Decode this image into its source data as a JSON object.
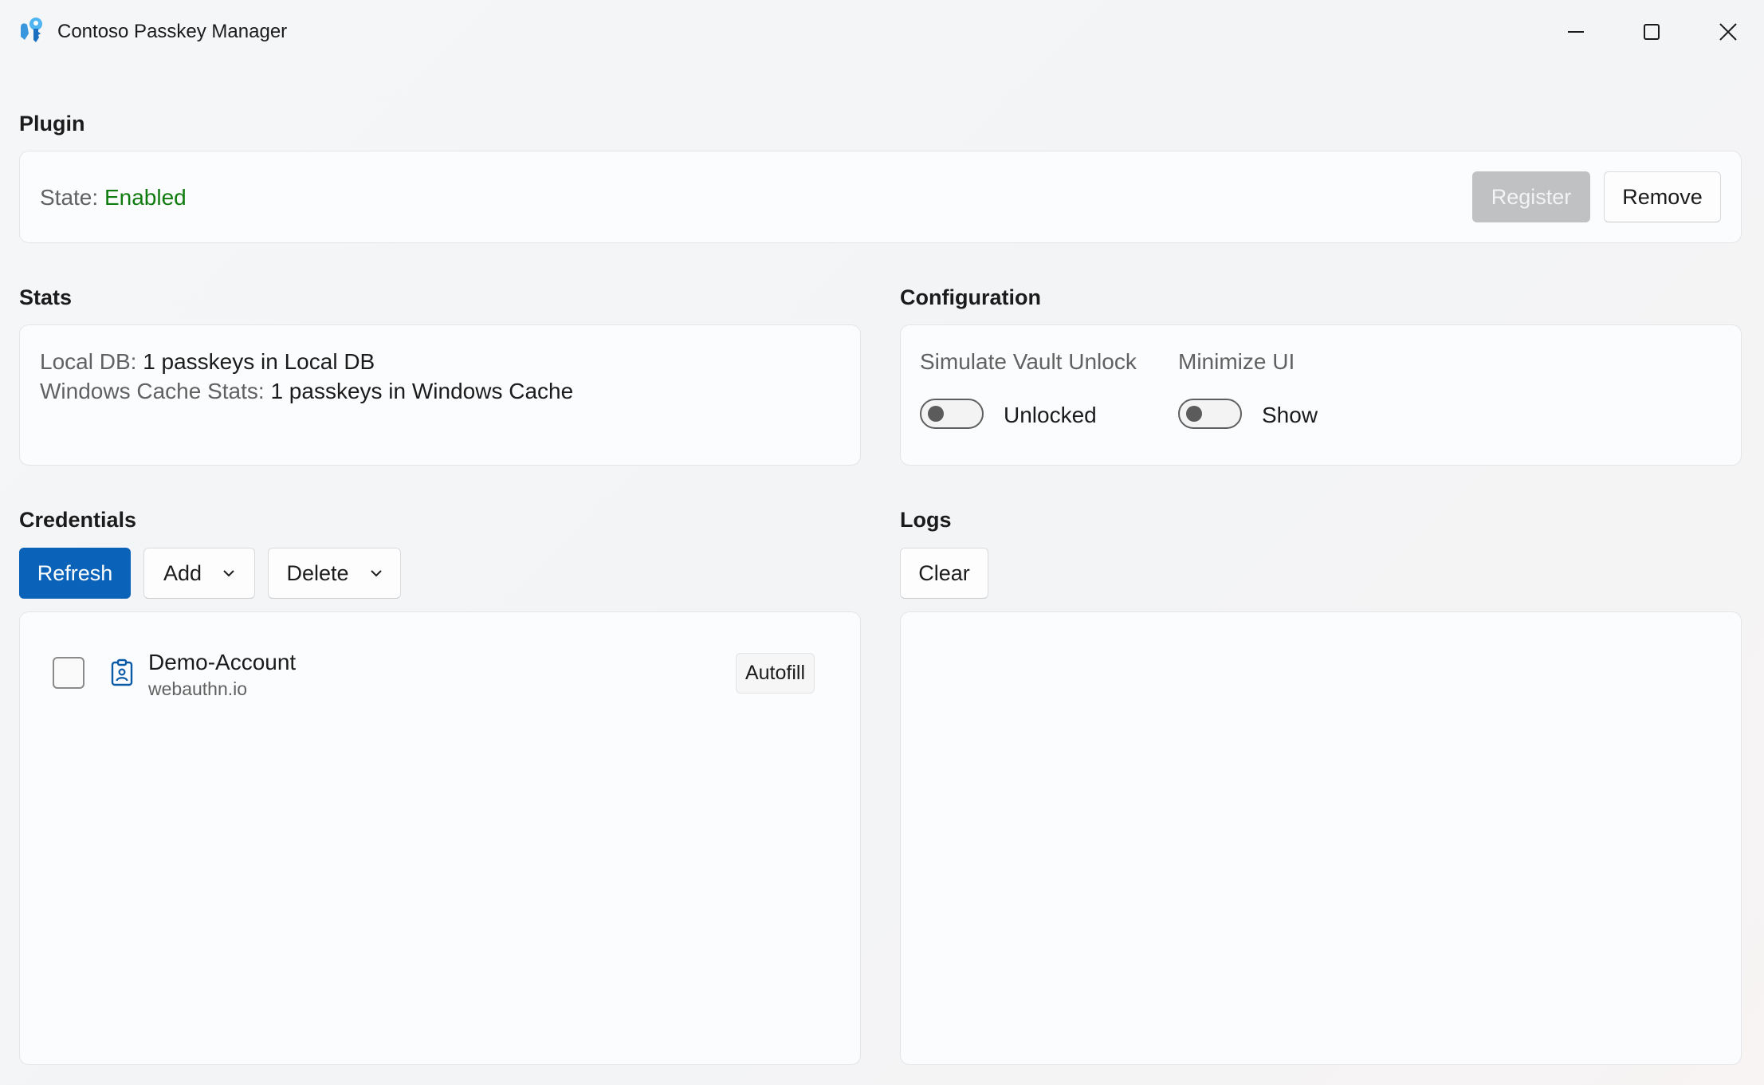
{
  "window": {
    "title": "Contoso Passkey Manager",
    "controls": [
      "minimize",
      "maximize",
      "close"
    ]
  },
  "plugin": {
    "heading": "Plugin",
    "state_label": "State:",
    "state_value": "Enabled",
    "state_color": "#107c10",
    "register_label": "Register",
    "register_enabled": false,
    "remove_label": "Remove"
  },
  "stats": {
    "heading": "Stats",
    "local_db_label": "Local DB:",
    "local_db_value": "1 passkeys in Local DB",
    "windows_cache_label": "Windows Cache Stats:",
    "windows_cache_value": "1 passkeys in Windows Cache"
  },
  "configuration": {
    "heading": "Configuration",
    "vault_unlock": {
      "label": "Simulate Vault Unlock",
      "toggle_on": false,
      "state_text": "Unlocked"
    },
    "minimize_ui": {
      "label": "Minimize UI",
      "toggle_on": false,
      "state_text": "Show"
    }
  },
  "credentials": {
    "heading": "Credentials",
    "refresh_label": "Refresh",
    "add_label": "Add",
    "delete_label": "Delete",
    "accent_color": "#0a63b8",
    "items": [
      {
        "name": "Demo-Account",
        "site": "webauthn.io",
        "checked": false,
        "icon": "passkey-badge-icon",
        "action_label": "Autofill"
      }
    ]
  },
  "logs": {
    "heading": "Logs",
    "clear_label": "Clear",
    "entries": []
  }
}
